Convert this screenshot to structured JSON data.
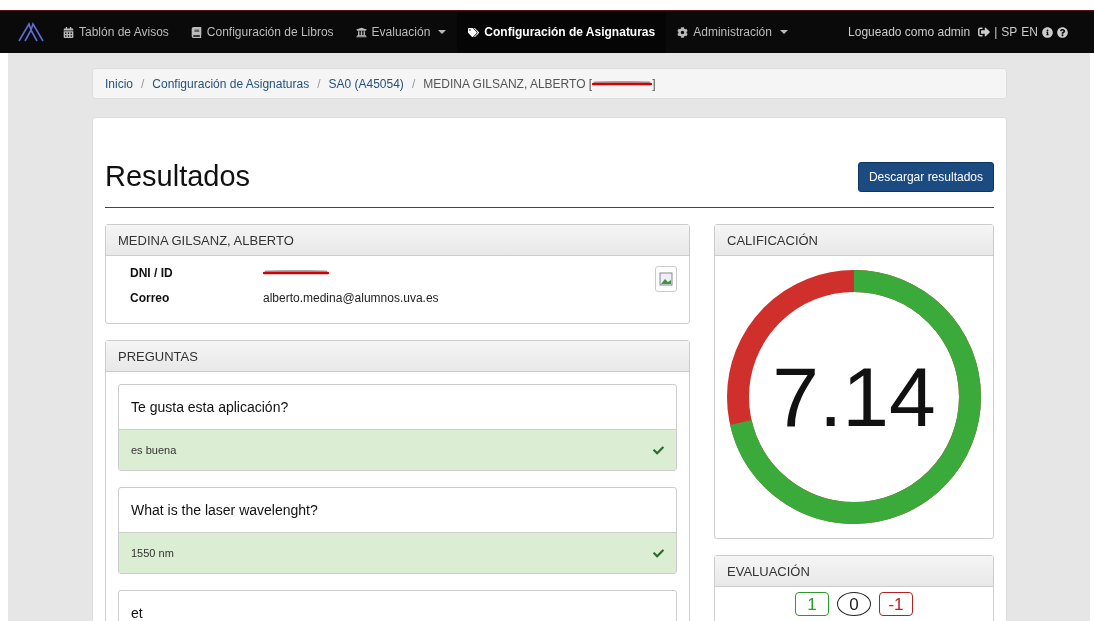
{
  "navbar": {
    "items": [
      {
        "label": "Tablón de Avisos",
        "kind": "calendar",
        "dropdown": false,
        "selected": false
      },
      {
        "label": "Configuración de Libros",
        "kind": "book",
        "dropdown": false,
        "selected": false
      },
      {
        "label": "Evaluación",
        "kind": "bank",
        "dropdown": true,
        "selected": false
      },
      {
        "label": "Configuración de Asignaturas",
        "kind": "tag",
        "dropdown": false,
        "selected": true
      },
      {
        "label": "Administración",
        "kind": "gear",
        "dropdown": true,
        "selected": false
      }
    ],
    "user": "Logueado como admin",
    "separator": "|",
    "languages": [
      "SP",
      "EN"
    ]
  },
  "breadcrumb": {
    "links": [
      "Inicio",
      "Configuración de Asignaturas",
      "SA0 (A45054)"
    ],
    "separators": [
      "/",
      "/",
      "/"
    ],
    "current": "MEDINA GILSANZ, ALBERTO",
    "open": "[",
    "close": "]"
  },
  "page": {
    "title": "Resultados",
    "download_button": "Descargar resultados"
  },
  "student": {
    "heading": "MEDINA GILSANZ, ALBERTO",
    "fields": [
      {
        "label": "DNI / ID",
        "redacted": true
      },
      {
        "label": "Correo",
        "value": "alberto.medina@alumnos.uva.es",
        "redacted": false
      }
    ]
  },
  "questions": {
    "heading": "PREGUNTAS",
    "items": [
      {
        "question": "Te gusta esta aplicación?",
        "answer": "es buena",
        "correct": true
      },
      {
        "question": "What is the laser wavelenght?",
        "answer": "1550 nm",
        "correct": true
      },
      {
        "question": "et"
      }
    ]
  },
  "grade": {
    "heading": "CALIFICACIÓN",
    "score": "7.14",
    "level": 0.714
  },
  "evaluation": {
    "heading": "EVALUACIÓN",
    "badges": [
      {
        "value": "1",
        "kind": "positive"
      },
      {
        "value": "0",
        "kind": "neutral"
      },
      {
        "value": "-1",
        "kind": "negative"
      }
    ]
  }
}
